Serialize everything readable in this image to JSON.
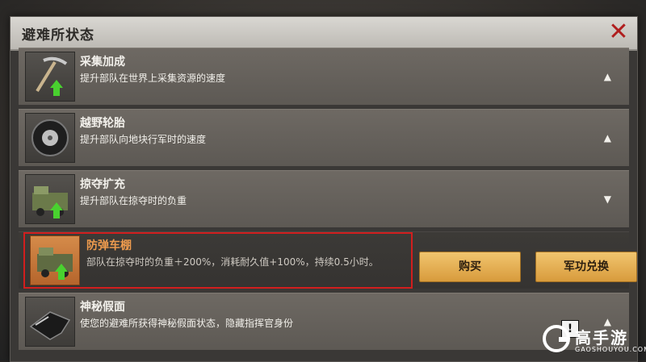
{
  "window": {
    "title": "避难所状态"
  },
  "items": [
    {
      "name": "采集加成",
      "desc": "提升部队在世界上采集资源的速度",
      "chevron": "▲",
      "icon": "pickaxe-icon"
    },
    {
      "name": "越野轮胎",
      "desc": "提升部队向地块行军时的速度",
      "chevron": "▲",
      "icon": "tire-icon"
    },
    {
      "name": "掠夺扩充",
      "desc": "提升部队在掠夺时的负重",
      "chevron": "▼",
      "icon": "armored-truck-icon"
    },
    {
      "name": "防弹车棚",
      "desc": "部队在掠夺时的负重＋200%，消耗耐久值+100%，持续0.5小时。",
      "buy_label": "购买",
      "exchange_label": "军功兑换",
      "icon": "armored-truck-icon"
    },
    {
      "name": "神秘假面",
      "desc": "使您的避难所获得神秘假面状态，隐藏指挥官身份",
      "warn": "!",
      "chevron": "▲",
      "icon": "mask-icon"
    }
  ],
  "watermark": {
    "brand": "高手游",
    "site": "GAOSHOUYOU.COM"
  },
  "colors": {
    "highlight": "#d21e1e",
    "accent_orange": "#ee9b4e",
    "button": "#e6b256"
  }
}
